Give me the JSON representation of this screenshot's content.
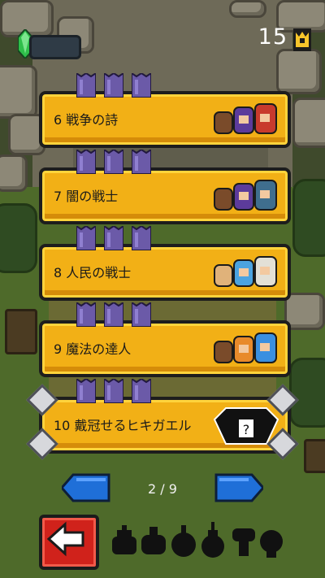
{
  "hud": {
    "crowns": "15",
    "icons": {
      "gem": "green-gem-icon",
      "crown": "crown-icon"
    }
  },
  "levels": [
    {
      "label": "6 戦争の詩",
      "style": "gold"
    },
    {
      "label": "7 闇の戦士",
      "style": "gold"
    },
    {
      "label": "8 人民の戦士",
      "style": "gold"
    },
    {
      "label": "9 魔法の達人",
      "style": "gold"
    },
    {
      "label": "10 戴冠せるヒキガエル",
      "style": "gold-silver-locked"
    }
  ],
  "pager": {
    "text": "2 / 9",
    "prev": "prev-page-arrow-icon",
    "next": "next-page-arrow-icon"
  },
  "bottom": {
    "back_icon": "back-arrow-icon",
    "unlockables": [
      "acorn-silhouette-icon",
      "leaf-silhouette-icon",
      "apple-silhouette-icon",
      "pear-silhouette-icon",
      "mushroom-silhouette-icon",
      "bulb-silhouette-icon"
    ]
  },
  "colors": {
    "card_gold": "#f2b016",
    "flag_purple": "#6b5aa8",
    "back_red": "#d0221b",
    "arrow_blue": "#1f6fd8",
    "gem_green": "#2fbf4a"
  }
}
